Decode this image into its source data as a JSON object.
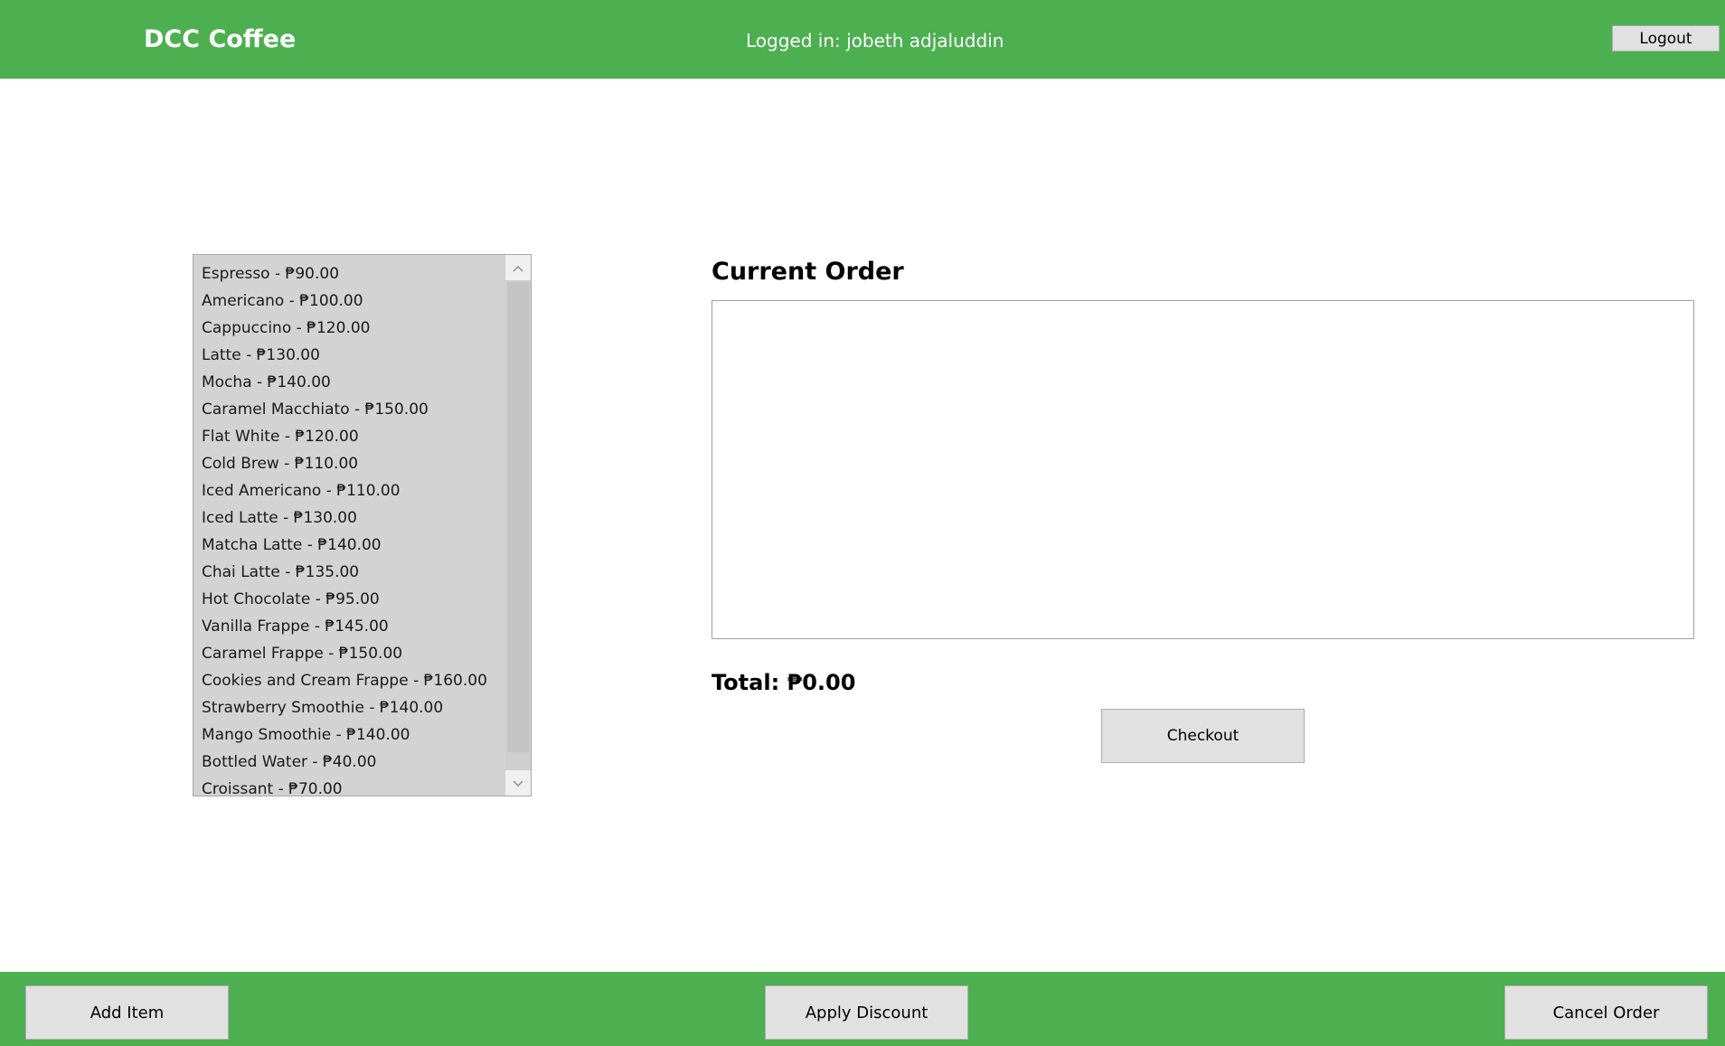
{
  "header": {
    "title": "DCC Coffee",
    "user_status": "Logged in: jobeth adjaluddin",
    "logout_label": "Logout"
  },
  "menu": {
    "items": [
      "Espresso - ₱90.00",
      "Americano - ₱100.00",
      "Cappuccino - ₱120.00",
      "Latte - ₱130.00",
      "Mocha - ₱140.00",
      "Caramel Macchiato - ₱150.00",
      "Flat White - ₱120.00",
      "Cold Brew - ₱110.00",
      "Iced Americano - ₱110.00",
      "Iced Latte - ₱130.00",
      "Matcha Latte - ₱140.00",
      "Chai Latte - ₱135.00",
      "Hot Chocolate - ₱95.00",
      "Vanilla Frappe - ₱145.00",
      "Caramel Frappe - ₱150.00",
      "Cookies and Cream Frappe - ₱160.00",
      "Strawberry Smoothie - ₱140.00",
      "Mango Smoothie - ₱140.00",
      "Bottled Water - ₱40.00",
      "Croissant - ₱70.00"
    ],
    "scroll_up_icon": "chevron-up-icon",
    "scroll_down_icon": "chevron-down-icon"
  },
  "order": {
    "heading": "Current Order",
    "items": [],
    "total_label": "Total: ₱0.00",
    "checkout_label": "Checkout"
  },
  "footer": {
    "add_item_label": "Add Item",
    "apply_discount_label": "Apply Discount",
    "cancel_order_label": "Cancel Order"
  },
  "colors": {
    "accent": "#4caf50",
    "button_face": "#e1e1e1",
    "list_background": "#d3d3d3"
  }
}
